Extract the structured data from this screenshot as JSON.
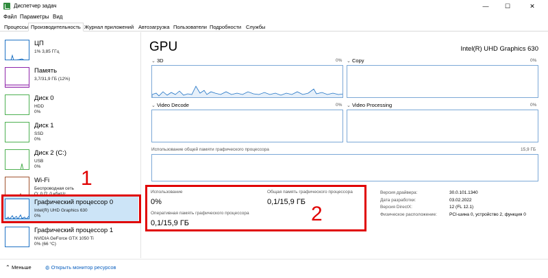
{
  "window": {
    "title": "Диспетчер задач",
    "minimize": "—",
    "maximize": "☐",
    "close": "✕"
  },
  "menu": [
    "Файл",
    "Параметры",
    "Вид"
  ],
  "tabs": [
    "Процессы",
    "Производительность",
    "Журнал приложений",
    "Автозагрузка",
    "Пользователи",
    "Подробности",
    "Службы"
  ],
  "sidebar": [
    {
      "title": "ЦП",
      "sub1": "1% 3,85 ГГц",
      "sub2": "",
      "color": "#1d71c4"
    },
    {
      "title": "Память",
      "sub1": "3,7/31,9 ГБ (12%)",
      "sub2": "",
      "color": "#8e24aa"
    },
    {
      "title": "Диск 0",
      "sub1": "HDD",
      "sub2": "0%",
      "color": "#4caf50"
    },
    {
      "title": "Диск 1",
      "sub1": "SSD",
      "sub2": "0%",
      "color": "#4caf50"
    },
    {
      "title": "Диск 2 (C:)",
      "sub1": "USB",
      "sub2": "0%",
      "color": "#4caf50"
    },
    {
      "title": "Wi-Fi",
      "sub1": "Беспроводная сеть",
      "sub2": "О: 0 П: 0 кбит/с",
      "color": "#a0522d"
    },
    {
      "title": "Графический процессор 0",
      "sub1": "Intel(R) UHD Graphics 630",
      "sub2": "0%",
      "color": "#1d71c4"
    },
    {
      "title": "Графический процессор 1",
      "sub1": "NVIDIA GeForce GTX 1050 Ti",
      "sub2": "0% (66 °C)",
      "color": "#1d71c4"
    }
  ],
  "main": {
    "title": "GPU",
    "model": "Intel(R) UHD Graphics 630",
    "engines": [
      {
        "label": "3D",
        "pct": "0%"
      },
      {
        "label": "Copy",
        "pct": "0%"
      },
      {
        "label": "Video Decode",
        "pct": "0%"
      },
      {
        "label": "Video Processing",
        "pct": "0%"
      }
    ],
    "shared_memory": {
      "label": "Использование общей памяти графического процессора",
      "max": "15,9 ГБ"
    },
    "stats": {
      "usage_label": "Использование",
      "usage_value": "0%",
      "shared_label": "Общая память графического процессора",
      "shared_value": "0,1/15,9 ГБ",
      "ram_label": "Оперативная память графического процессора",
      "ram_value": "0,1/15,9 ГБ"
    },
    "info": [
      {
        "key": "Версия драйвера:",
        "value": "30.0.101.1340"
      },
      {
        "key": "Дата разработки:",
        "value": "03.02.2022"
      },
      {
        "key": "Версия DirectX:",
        "value": "12 (FL 12.1)"
      },
      {
        "key": "Физическое расположение:",
        "value": "PCI-шина 0, устройство 2, функция 0"
      }
    ]
  },
  "annotations": {
    "one": "1",
    "two": "2"
  },
  "footer": {
    "less": "Меньше",
    "monitor": "Открыть монитор ресурсов"
  }
}
